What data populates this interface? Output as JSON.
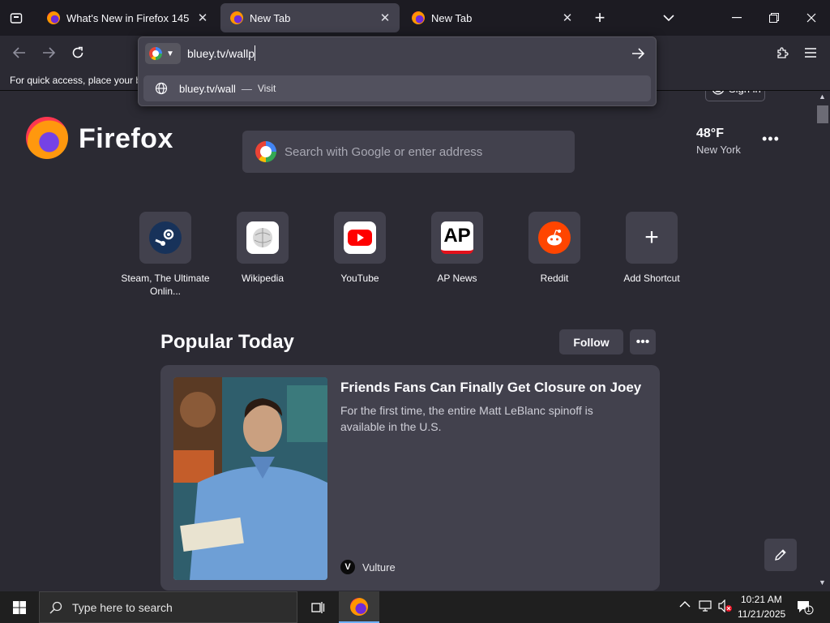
{
  "tabs": [
    {
      "title": "What's New in Firefox 145",
      "active": false
    },
    {
      "title": "New Tab",
      "active": true
    },
    {
      "title": "New Tab",
      "active": false
    }
  ],
  "address_bar": {
    "value": "bluey.tv/wallp",
    "suggestion_url": "bluey.tv/wall",
    "suggestion_sep": "—",
    "suggestion_action": "Visit"
  },
  "toolbar": {
    "sign_in": "Sign in"
  },
  "bookmarks_hint": "For quick access, place your b",
  "brand": {
    "wordmark": "Firefox"
  },
  "page_search": {
    "placeholder": "Search with Google or enter address"
  },
  "weather": {
    "temp": "48°F",
    "city": "New York"
  },
  "shortcuts": [
    {
      "label": "Steam, The Ultimate Onlin..."
    },
    {
      "label": "Wikipedia"
    },
    {
      "label": "YouTube"
    },
    {
      "label": "AP News",
      "icon_text": "AP"
    },
    {
      "label": "Reddit"
    },
    {
      "label": "Add Shortcut"
    }
  ],
  "popular": {
    "title": "Popular Today",
    "follow": "Follow",
    "story": {
      "headline": "Friends Fans Can Finally Get Closure on Joey",
      "description": "For the first time, the entire Matt LeBlanc spinoff is available in the U.S.",
      "source": "Vulture",
      "source_icon": "V"
    }
  },
  "taskbar": {
    "search_placeholder": "Type here to search",
    "time": "10:21 AM",
    "date": "11/21/2025",
    "notification_count": "1"
  },
  "colors": {
    "bg": "#2b2a33",
    "tabstrip": "#1c1b22",
    "surface": "#42414d",
    "accent": "#00ddff"
  }
}
